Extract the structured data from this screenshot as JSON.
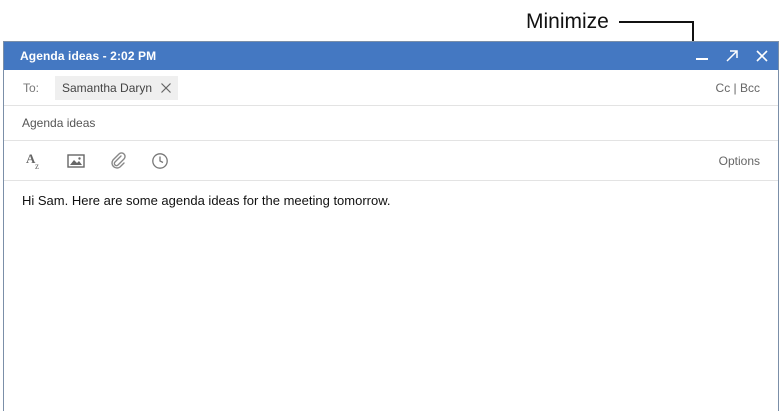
{
  "annotation": {
    "label": "Minimize"
  },
  "window": {
    "title": "Agenda ideas - 2:02 PM",
    "controls": [
      "minimize-icon",
      "expand-icon",
      "close-icon"
    ]
  },
  "compose": {
    "to_label": "To:",
    "recipients": [
      {
        "name": "Samantha Daryn"
      }
    ],
    "cc_bcc_label": "Cc | Bcc",
    "subject": "Agenda ideas",
    "toolbar": {
      "icons": [
        "text-format-icon",
        "insert-image-icon",
        "attach-icon",
        "schedule-icon"
      ],
      "options_label": "Options"
    },
    "body": "Hi Sam. Here are some agenda ideas for the meeting tomorrow."
  },
  "colors": {
    "titlebar": "#4478c2",
    "chip_background": "#efefef"
  }
}
